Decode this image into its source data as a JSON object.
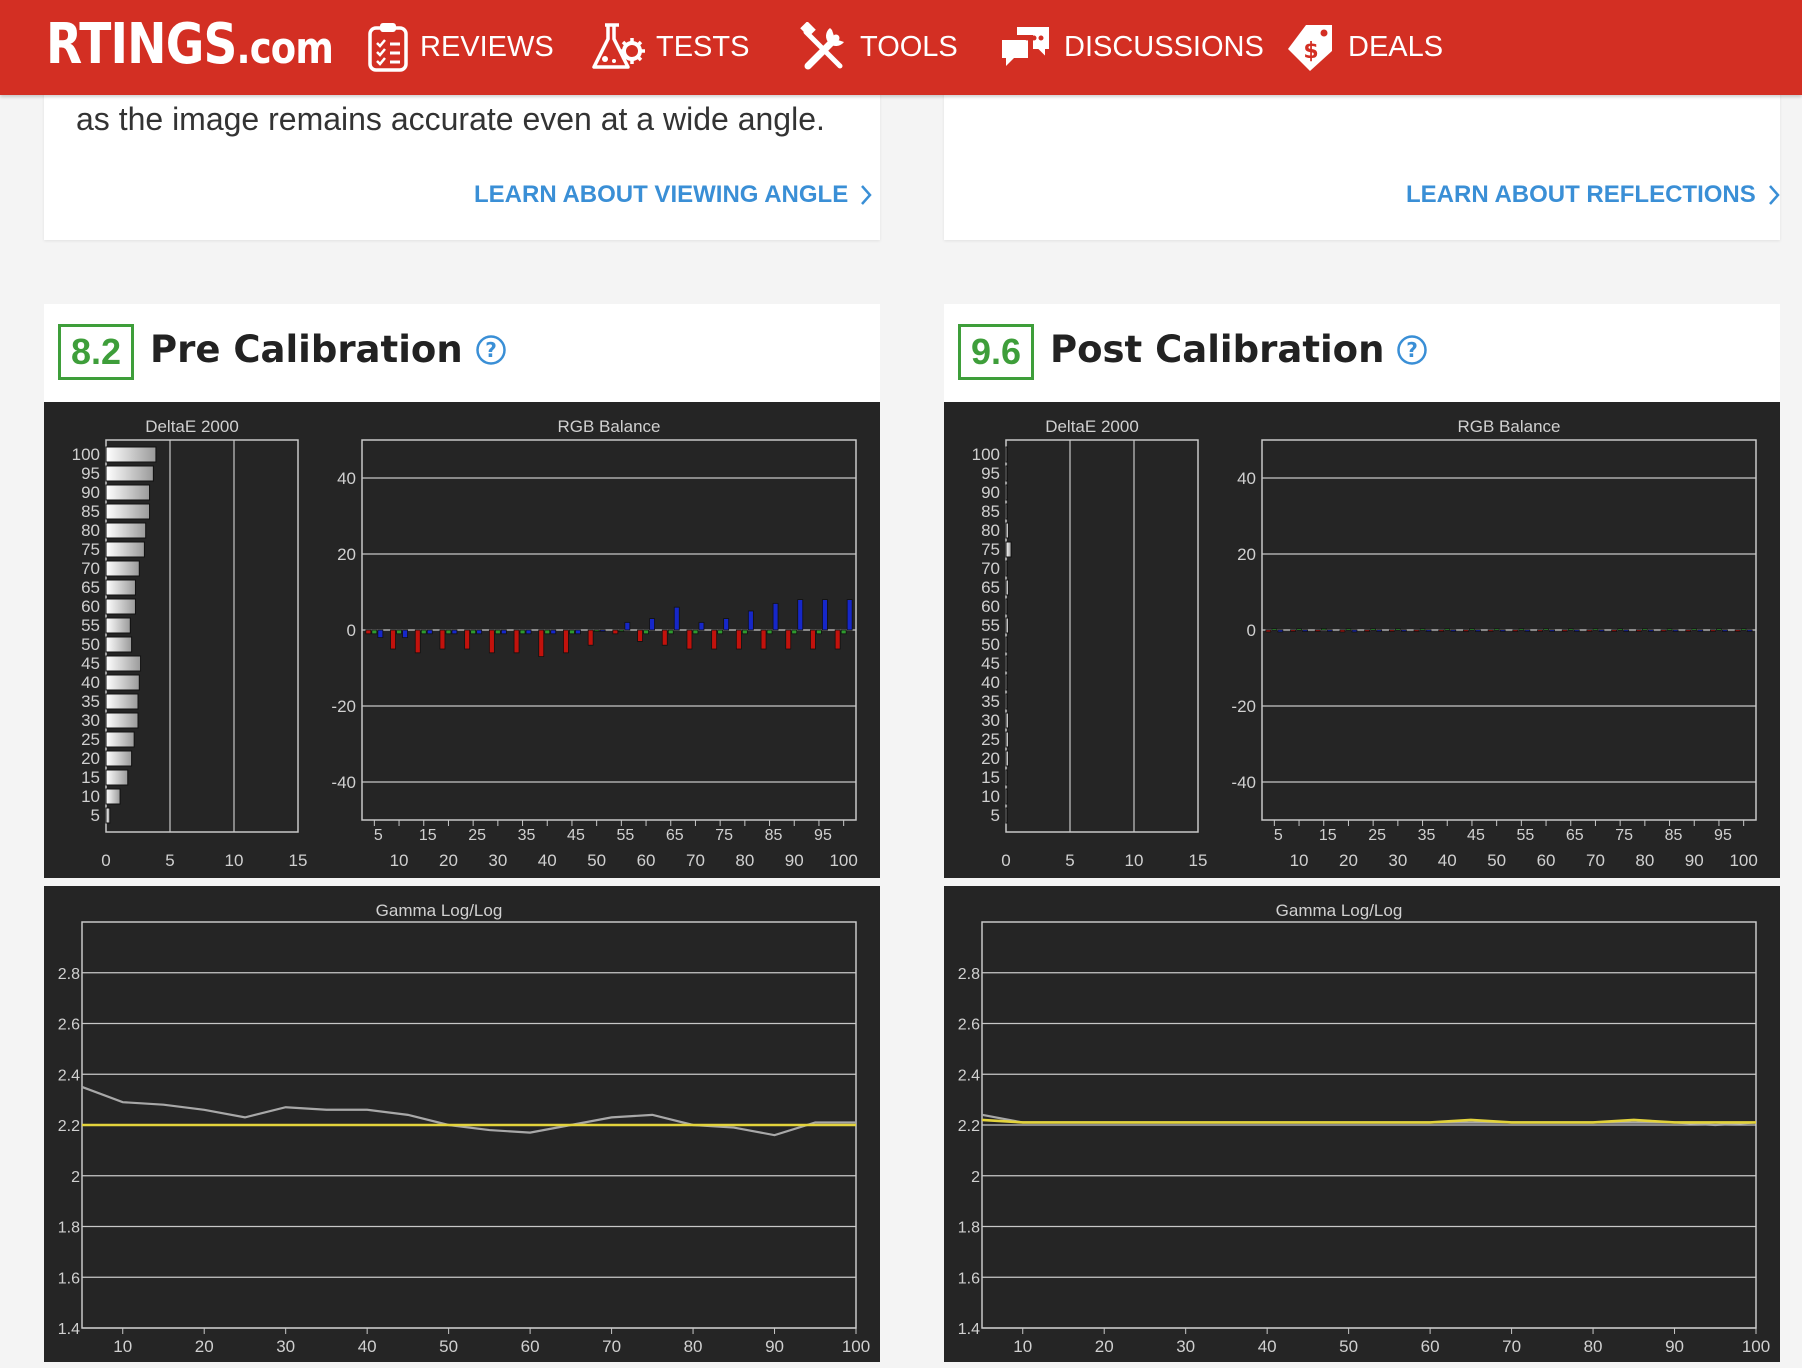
{
  "brand": {
    "logo_main": "RTINGS",
    "logo_suffix": ".com"
  },
  "nav": [
    {
      "label": "REVIEWS",
      "icon": "clipboard-icon"
    },
    {
      "label": "TESTS",
      "icon": "flask-gear-icon"
    },
    {
      "label": "TOOLS",
      "icon": "tools-icon"
    },
    {
      "label": "DISCUSSIONS",
      "icon": "chat-bubbles-icon"
    },
    {
      "label": "DEALS",
      "icon": "price-tag-icon"
    }
  ],
  "cards": {
    "viewing_angle": {
      "text": "as the image remains accurate even at a wide angle.",
      "link": "LEARN ABOUT VIEWING ANGLE"
    },
    "reflections": {
      "link": "LEARN ABOUT REFLECTIONS"
    }
  },
  "sections": {
    "pre": {
      "score": "8.2",
      "title": "Pre Calibration"
    },
    "post": {
      "score": "9.6",
      "title": "Post Calibration"
    }
  },
  "colors": {
    "brand_red": "#d32f23",
    "score_green": "#3e9e3a",
    "link_blue": "#3a8fd6",
    "chart_bg": "#252525",
    "gamma_target": "#e3d33c"
  },
  "chart_data": [
    {
      "id": "pre-deltae",
      "type": "bar",
      "title": "DeltaE 2000",
      "orientation": "horizontal",
      "categories": [
        5,
        10,
        15,
        20,
        25,
        30,
        35,
        40,
        45,
        50,
        55,
        60,
        65,
        70,
        75,
        80,
        85,
        90,
        95,
        100
      ],
      "values": [
        0.3,
        1.1,
        1.7,
        2.0,
        2.2,
        2.5,
        2.5,
        2.6,
        2.7,
        2.0,
        1.9,
        2.3,
        2.3,
        2.6,
        3.0,
        3.1,
        3.4,
        3.4,
        3.7,
        3.9
      ],
      "xlim": [
        0,
        15
      ],
      "xticks": [
        0,
        5,
        10,
        15
      ],
      "yticks": [
        100,
        95,
        90,
        85,
        80,
        75,
        70,
        65,
        60,
        55,
        50,
        45,
        40,
        35,
        30,
        25,
        20,
        15,
        10,
        5
      ]
    },
    {
      "id": "pre-rgb",
      "type": "bar",
      "title": "RGB Balance",
      "ylim": [
        -50,
        50
      ],
      "yticks": [
        40,
        20,
        0,
        -20,
        -40
      ],
      "x_top_labels": [
        "5",
        "15",
        "25",
        "35",
        "45",
        "55",
        "65",
        "75",
        "85",
        "95"
      ],
      "x_bottom_labels": [
        "10",
        "20",
        "30",
        "40",
        "50",
        "60",
        "70",
        "80",
        "90",
        "100"
      ],
      "categories": [
        5,
        10,
        15,
        20,
        25,
        30,
        35,
        40,
        45,
        50,
        55,
        60,
        65,
        70,
        75,
        80,
        85,
        90,
        95,
        100
      ],
      "series": [
        {
          "color": "red",
          "values": [
            -1,
            -5,
            -6,
            -5,
            -5,
            -6,
            -6,
            -7,
            -6,
            -4,
            -1,
            -3,
            -4,
            -5,
            -5,
            -5,
            -5,
            -5,
            -5,
            -5
          ]
        },
        {
          "color": "green",
          "values": [
            -1,
            -1,
            -1,
            -1,
            -1,
            -1,
            -1,
            -1,
            -1,
            0,
            0,
            -1,
            -1,
            -1,
            -1,
            -1,
            -1,
            -1,
            -1,
            -1
          ]
        },
        {
          "color": "blue",
          "values": [
            -2,
            -2,
            -1,
            -1,
            -1,
            -1,
            -1,
            -1,
            -1,
            0,
            2,
            3,
            6,
            2,
            3,
            5,
            7,
            8,
            8,
            8
          ]
        }
      ]
    },
    {
      "id": "pre-gamma",
      "type": "line",
      "title": "Gamma Log/Log",
      "ylim": [
        1.4,
        3.0
      ],
      "yticks": [
        "2.8",
        "2.6",
        "2.4",
        "2.2",
        "2",
        "1.8",
        "1.6",
        "1.4"
      ],
      "xlim": [
        5,
        100
      ],
      "xticks": [
        10,
        20,
        30,
        40,
        50,
        60,
        70,
        80,
        90,
        100
      ],
      "series": [
        {
          "name": "",
          "color": "#a8a8a8",
          "x": [
            5,
            10,
            15,
            20,
            25,
            30,
            35,
            40,
            45,
            50,
            55,
            60,
            65,
            70,
            75,
            80,
            85,
            90,
            95,
            100
          ],
          "y": [
            2.35,
            2.29,
            2.28,
            2.26,
            2.23,
            2.27,
            2.26,
            2.26,
            2.24,
            2.2,
            2.18,
            2.17,
            2.2,
            2.23,
            2.24,
            2.2,
            2.19,
            2.16,
            2.21,
            2.21
          ]
        },
        {
          "name": "",
          "color": "#e3d33c",
          "x": [
            5,
            100
          ],
          "y": [
            2.2,
            2.2
          ]
        }
      ]
    },
    {
      "id": "post-deltae",
      "type": "bar",
      "title": "DeltaE 2000",
      "orientation": "horizontal",
      "categories": [
        5,
        10,
        15,
        20,
        25,
        30,
        35,
        40,
        45,
        50,
        55,
        60,
        65,
        70,
        75,
        80,
        85,
        90,
        95,
        100
      ],
      "values": [
        0.1,
        0.1,
        0.1,
        0.2,
        0.2,
        0.2,
        0.1,
        0.1,
        0.1,
        0.1,
        0.2,
        0.1,
        0.2,
        0.1,
        0.4,
        0.2,
        0.1,
        0.1,
        0.1,
        0.1
      ],
      "xlim": [
        0,
        15
      ],
      "xticks": [
        0,
        5,
        10,
        15
      ],
      "yticks": [
        100,
        95,
        90,
        85,
        80,
        75,
        70,
        65,
        60,
        55,
        50,
        45,
        40,
        35,
        30,
        25,
        20,
        15,
        10,
        5
      ]
    },
    {
      "id": "post-rgb",
      "type": "bar",
      "title": "RGB Balance",
      "ylim": [
        -50,
        50
      ],
      "yticks": [
        40,
        20,
        0,
        -20,
        -40
      ],
      "x_top_labels": [
        "5",
        "15",
        "25",
        "35",
        "45",
        "55",
        "65",
        "75",
        "85",
        "95"
      ],
      "x_bottom_labels": [
        "10",
        "20",
        "30",
        "40",
        "50",
        "60",
        "70",
        "80",
        "90",
        "100"
      ],
      "categories": [
        5,
        10,
        15,
        20,
        25,
        30,
        35,
        40,
        45,
        50,
        55,
        60,
        65,
        70,
        75,
        80,
        85,
        90,
        95,
        100
      ],
      "series": [
        {
          "color": "red",
          "values": [
            -0.5,
            -0.3,
            -0.3,
            -0.5,
            -0.4,
            -0.3,
            -0.3,
            -0.3,
            -0.3,
            -0.3,
            -0.3,
            -0.3,
            -0.3,
            -0.3,
            -0.3,
            -0.3,
            -0.3,
            -0.3,
            -0.3,
            -0.3
          ]
        },
        {
          "color": "green",
          "values": [
            0.3,
            0.3,
            0.4,
            0.3,
            0.3,
            0.3,
            0.3,
            0.3,
            0.3,
            0.3,
            0.3,
            0.3,
            0.3,
            0.3,
            0.3,
            0.3,
            0.3,
            0.3,
            0.3,
            0.3
          ]
        },
        {
          "color": "blue",
          "values": [
            -0.5,
            -0.4,
            -0.4,
            -0.5,
            -0.4,
            -0.3,
            -0.3,
            -0.3,
            -0.4,
            -0.3,
            -0.3,
            -0.3,
            -0.3,
            -0.3,
            -0.3,
            -0.3,
            -0.3,
            -0.3,
            -0.3,
            -0.3
          ]
        }
      ]
    },
    {
      "id": "post-gamma",
      "type": "line",
      "title": "Gamma Log/Log",
      "ylim": [
        1.4,
        3.0
      ],
      "yticks": [
        "2.8",
        "2.6",
        "2.4",
        "2.2",
        "2",
        "1.8",
        "1.6",
        "1.4"
      ],
      "xlim": [
        5,
        100
      ],
      "xticks": [
        10,
        20,
        30,
        40,
        50,
        60,
        70,
        80,
        90,
        100
      ],
      "series": [
        {
          "name": "",
          "color": "#a8a8a8",
          "x": [
            5,
            10,
            15,
            20,
            25,
            30,
            35,
            40,
            45,
            50,
            55,
            60,
            65,
            70,
            75,
            80,
            85,
            90,
            95,
            100
          ],
          "y": [
            2.24,
            2.21,
            2.21,
            2.21,
            2.21,
            2.21,
            2.21,
            2.21,
            2.21,
            2.21,
            2.21,
            2.21,
            2.21,
            2.21,
            2.21,
            2.21,
            2.21,
            2.21,
            2.2,
            2.21
          ]
        },
        {
          "name": "",
          "color": "#e3d33c",
          "x": [
            5,
            10,
            15,
            20,
            25,
            30,
            35,
            40,
            45,
            50,
            55,
            60,
            65,
            70,
            75,
            80,
            85,
            90,
            95,
            100
          ],
          "y": [
            2.22,
            2.21,
            2.21,
            2.21,
            2.21,
            2.21,
            2.21,
            2.21,
            2.21,
            2.21,
            2.21,
            2.21,
            2.22,
            2.21,
            2.21,
            2.21,
            2.22,
            2.21,
            2.21,
            2.21
          ]
        }
      ]
    }
  ]
}
